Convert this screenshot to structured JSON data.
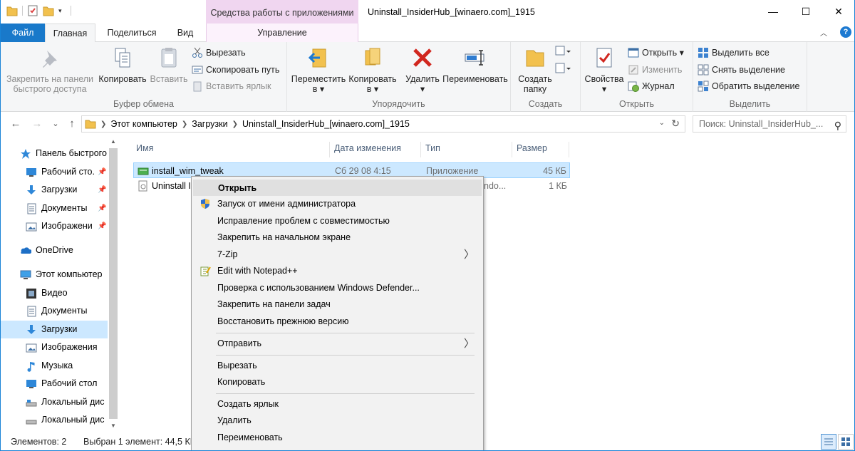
{
  "window": {
    "title": "Uninstall_InsiderHub_[winaero.com]_1915",
    "context_tools_label": "Средства работы с приложениями",
    "minimize": "—",
    "maximize": "☐",
    "close": "✕"
  },
  "tabs": {
    "file": "Файл",
    "home": "Главная",
    "share": "Поделиться",
    "view": "Вид",
    "manage": "Управление",
    "help": "?"
  },
  "ribbon": {
    "clipboard": {
      "pin_line1": "Закрепить на панели",
      "pin_line2": "быстрого доступа",
      "copy": "Копировать",
      "paste": "Вставить",
      "cut": "Вырезать",
      "copy_path": "Скопировать путь",
      "paste_shortcut": "Вставить ярлык",
      "label": "Буфер обмена"
    },
    "organize": {
      "move_line1": "Переместить",
      "move_line2": "в ▾",
      "copy_line1": "Копировать",
      "copy_line2": "в ▾",
      "delete": "Удалить",
      "delete_arrow": "▾",
      "rename": "Переименовать",
      "label": "Упорядочить"
    },
    "create": {
      "new_folder_line1": "Создать",
      "new_folder_line2": "папку",
      "label": "Создать"
    },
    "open": {
      "properties": "Свойства",
      "properties_arrow": "▾",
      "open": "Открыть ▾",
      "edit": "Изменить",
      "history": "Журнал",
      "label": "Открыть"
    },
    "select": {
      "select_all": "Выделить все",
      "select_none": "Снять выделение",
      "invert": "Обратить выделение",
      "label": "Выделить"
    }
  },
  "address": {
    "back": "←",
    "forward": "→",
    "recent": "⌄",
    "up": "↑",
    "crumbs": [
      "Этот компьютер",
      "Загрузки",
      "Uninstall_InsiderHub_[winaero.com]_1915"
    ],
    "search_placeholder": "Поиск: Uninstall_InsiderHub_..."
  },
  "nav": {
    "items": [
      {
        "label": "Панель быстрого",
        "icon": "star-icon"
      },
      {
        "label": "Рабочий сто.",
        "icon": "desktop-icon"
      },
      {
        "label": "Загрузки",
        "icon": "download-icon"
      },
      {
        "label": "Документы",
        "icon": "documents-icon"
      },
      {
        "label": "Изображени",
        "icon": "pictures-icon"
      },
      {
        "label": "OneDrive",
        "icon": "onedrive-icon"
      },
      {
        "label": "Этот компьютер",
        "icon": "computer-icon"
      },
      {
        "label": "Видео",
        "icon": "video-icon"
      },
      {
        "label": "Документы",
        "icon": "documents-icon"
      },
      {
        "label": "Загрузки",
        "icon": "download-icon"
      },
      {
        "label": "Изображения",
        "icon": "pictures-icon"
      },
      {
        "label": "Музыка",
        "icon": "music-icon"
      },
      {
        "label": "Рабочий стол",
        "icon": "desktop-icon"
      },
      {
        "label": "Локальный дис",
        "icon": "disk-icon"
      },
      {
        "label": "Локальный дис",
        "icon": "disk-icon"
      }
    ]
  },
  "list": {
    "columns": [
      "Имя",
      "Дата изменения",
      "Тип",
      "Размер"
    ],
    "rows": [
      {
        "name": "install_wim_tweak",
        "date": "Сб 29 08 4:15",
        "type": "Приложение",
        "size": "45 КБ"
      },
      {
        "name": "Uninstall I",
        "date": "",
        "type": "ndo...",
        "size": "1 КБ"
      }
    ]
  },
  "status": {
    "count": "Элементов: 2",
    "selection": "Выбран 1 элемент: 44,5 КБ"
  },
  "context_menu": {
    "items": [
      {
        "label": "Открыть"
      },
      {
        "label": "Запуск от имени администратора"
      },
      {
        "label": "Исправление проблем с совместимостью"
      },
      {
        "label": "Закрепить на начальном экране"
      },
      {
        "label": "7-Zip"
      },
      {
        "label": "Edit with Notepad++"
      },
      {
        "label": "Проверка с использованием Windows Defender..."
      },
      {
        "label": "Закрепить на панели задач"
      },
      {
        "label": "Восстановить прежнюю версию"
      },
      {
        "label": "Отправить"
      },
      {
        "label": "Вырезать"
      },
      {
        "label": "Копировать"
      },
      {
        "label": "Создать ярлык"
      },
      {
        "label": "Удалить"
      },
      {
        "label": "Переименовать"
      }
    ],
    "submenu_arrow": "〉"
  }
}
